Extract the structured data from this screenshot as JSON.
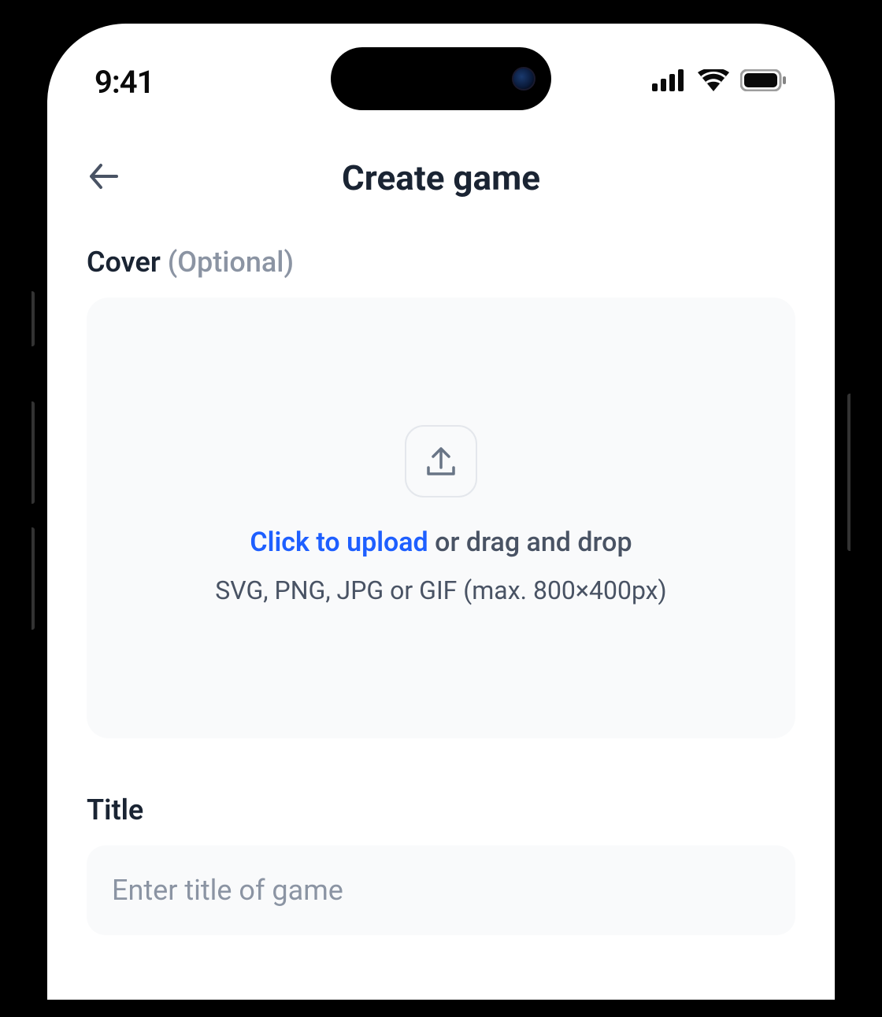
{
  "status_bar": {
    "time": "9:41"
  },
  "header": {
    "title": "Create game"
  },
  "cover": {
    "label": "Cover",
    "optional_tag": "(Optional)",
    "click_to_upload": "Click to upload",
    "drag_drop_suffix": " or drag and drop",
    "hint": "SVG, PNG, JPG or GIF (max. 800×400px)"
  },
  "title_field": {
    "label": "Title",
    "placeholder": "Enter title of game",
    "value": ""
  }
}
